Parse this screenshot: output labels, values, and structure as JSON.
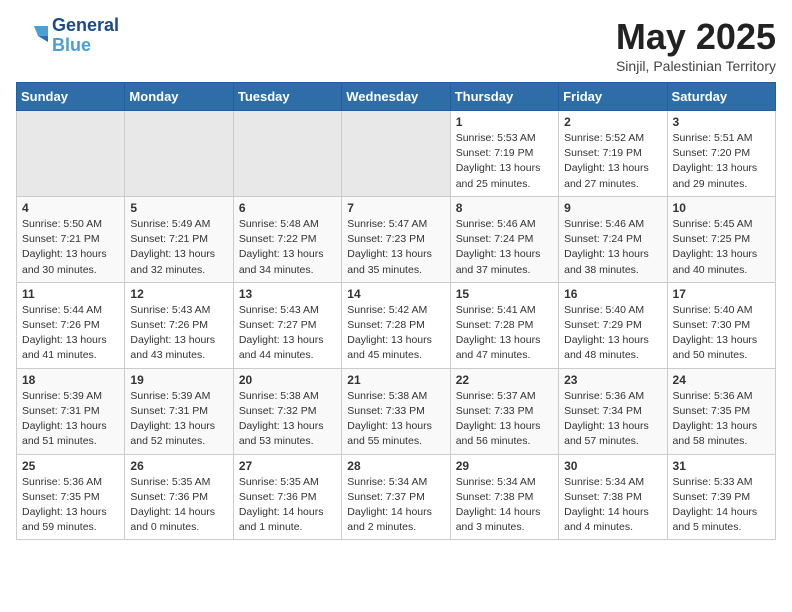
{
  "header": {
    "logo_line1": "General",
    "logo_line2": "Blue",
    "month": "May 2025",
    "location": "Sinjil, Palestinian Territory"
  },
  "days_of_week": [
    "Sunday",
    "Monday",
    "Tuesday",
    "Wednesday",
    "Thursday",
    "Friday",
    "Saturday"
  ],
  "weeks": [
    [
      {
        "day": "",
        "empty": true
      },
      {
        "day": "",
        "empty": true
      },
      {
        "day": "",
        "empty": true
      },
      {
        "day": "",
        "empty": true
      },
      {
        "day": "1",
        "sunrise": "5:53 AM",
        "sunset": "7:19 PM",
        "daylight": "13 hours and 25 minutes."
      },
      {
        "day": "2",
        "sunrise": "5:52 AM",
        "sunset": "7:19 PM",
        "daylight": "13 hours and 27 minutes."
      },
      {
        "day": "3",
        "sunrise": "5:51 AM",
        "sunset": "7:20 PM",
        "daylight": "13 hours and 29 minutes."
      }
    ],
    [
      {
        "day": "4",
        "sunrise": "5:50 AM",
        "sunset": "7:21 PM",
        "daylight": "13 hours and 30 minutes."
      },
      {
        "day": "5",
        "sunrise": "5:49 AM",
        "sunset": "7:21 PM",
        "daylight": "13 hours and 32 minutes."
      },
      {
        "day": "6",
        "sunrise": "5:48 AM",
        "sunset": "7:22 PM",
        "daylight": "13 hours and 34 minutes."
      },
      {
        "day": "7",
        "sunrise": "5:47 AM",
        "sunset": "7:23 PM",
        "daylight": "13 hours and 35 minutes."
      },
      {
        "day": "8",
        "sunrise": "5:46 AM",
        "sunset": "7:24 PM",
        "daylight": "13 hours and 37 minutes."
      },
      {
        "day": "9",
        "sunrise": "5:46 AM",
        "sunset": "7:24 PM",
        "daylight": "13 hours and 38 minutes."
      },
      {
        "day": "10",
        "sunrise": "5:45 AM",
        "sunset": "7:25 PM",
        "daylight": "13 hours and 40 minutes."
      }
    ],
    [
      {
        "day": "11",
        "sunrise": "5:44 AM",
        "sunset": "7:26 PM",
        "daylight": "13 hours and 41 minutes."
      },
      {
        "day": "12",
        "sunrise": "5:43 AM",
        "sunset": "7:26 PM",
        "daylight": "13 hours and 43 minutes."
      },
      {
        "day": "13",
        "sunrise": "5:43 AM",
        "sunset": "7:27 PM",
        "daylight": "13 hours and 44 minutes."
      },
      {
        "day": "14",
        "sunrise": "5:42 AM",
        "sunset": "7:28 PM",
        "daylight": "13 hours and 45 minutes."
      },
      {
        "day": "15",
        "sunrise": "5:41 AM",
        "sunset": "7:28 PM",
        "daylight": "13 hours and 47 minutes."
      },
      {
        "day": "16",
        "sunrise": "5:40 AM",
        "sunset": "7:29 PM",
        "daylight": "13 hours and 48 minutes."
      },
      {
        "day": "17",
        "sunrise": "5:40 AM",
        "sunset": "7:30 PM",
        "daylight": "13 hours and 50 minutes."
      }
    ],
    [
      {
        "day": "18",
        "sunrise": "5:39 AM",
        "sunset": "7:31 PM",
        "daylight": "13 hours and 51 minutes."
      },
      {
        "day": "19",
        "sunrise": "5:39 AM",
        "sunset": "7:31 PM",
        "daylight": "13 hours and 52 minutes."
      },
      {
        "day": "20",
        "sunrise": "5:38 AM",
        "sunset": "7:32 PM",
        "daylight": "13 hours and 53 minutes."
      },
      {
        "day": "21",
        "sunrise": "5:38 AM",
        "sunset": "7:33 PM",
        "daylight": "13 hours and 55 minutes."
      },
      {
        "day": "22",
        "sunrise": "5:37 AM",
        "sunset": "7:33 PM",
        "daylight": "13 hours and 56 minutes."
      },
      {
        "day": "23",
        "sunrise": "5:36 AM",
        "sunset": "7:34 PM",
        "daylight": "13 hours and 57 minutes."
      },
      {
        "day": "24",
        "sunrise": "5:36 AM",
        "sunset": "7:35 PM",
        "daylight": "13 hours and 58 minutes."
      }
    ],
    [
      {
        "day": "25",
        "sunrise": "5:36 AM",
        "sunset": "7:35 PM",
        "daylight": "13 hours and 59 minutes."
      },
      {
        "day": "26",
        "sunrise": "5:35 AM",
        "sunset": "7:36 PM",
        "daylight": "14 hours and 0 minutes."
      },
      {
        "day": "27",
        "sunrise": "5:35 AM",
        "sunset": "7:36 PM",
        "daylight": "14 hours and 1 minute."
      },
      {
        "day": "28",
        "sunrise": "5:34 AM",
        "sunset": "7:37 PM",
        "daylight": "14 hours and 2 minutes."
      },
      {
        "day": "29",
        "sunrise": "5:34 AM",
        "sunset": "7:38 PM",
        "daylight": "14 hours and 3 minutes."
      },
      {
        "day": "30",
        "sunrise": "5:34 AM",
        "sunset": "7:38 PM",
        "daylight": "14 hours and 4 minutes."
      },
      {
        "day": "31",
        "sunrise": "5:33 AM",
        "sunset": "7:39 PM",
        "daylight": "14 hours and 5 minutes."
      }
    ]
  ]
}
